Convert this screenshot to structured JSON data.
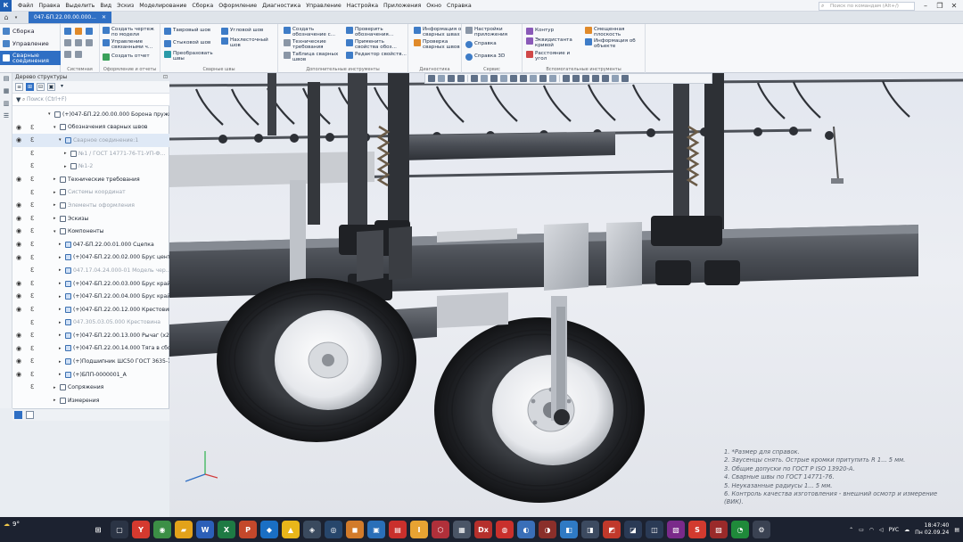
{
  "menubar": {
    "logo": "К",
    "items": [
      "Файл",
      "Правка",
      "Выделить",
      "Вид",
      "Эскиз",
      "Моделирование",
      "Сборка",
      "Оформление",
      "Диагностика",
      "Управление",
      "Настройка",
      "Приложения",
      "Окно",
      "Справка"
    ],
    "search_placeholder": "Поиск по командам (Alt+/)"
  },
  "tabbar": {
    "doc_tab": "047-БП.22.00.00.000..."
  },
  "ribbon": {
    "left_items": [
      "Сборка",
      "Управление",
      "Сварные соединения"
    ],
    "groups": [
      {
        "label": "Системная",
        "buttons": []
      },
      {
        "label": "Оформление и отчеты",
        "buttons": [
          "Создать чертеж по модели",
          "Управление связанными ч...",
          "Создать отчет"
        ]
      },
      {
        "label": "Сварные швы",
        "buttons": [
          "Тавровый шов",
          "Угловой шов",
          "Стыковой шов",
          "Нахлесточный шов",
          "Преобразовать швы"
        ]
      },
      {
        "label": "Дополнительные инструменты",
        "buttons": [
          "Создать обозначение с...",
          "Технические требования",
          "Таблица сварных швов",
          "Проверить обозначения...",
          "Применить свойства обоз...",
          "Редактор свойств..."
        ]
      },
      {
        "label": "Диагностика",
        "buttons": [
          "Информация о сварных швах",
          "Проверка сварных швов"
        ]
      },
      {
        "label": "Сервис",
        "buttons": [
          "Настройки приложения",
          "Справка",
          "Справка 3D"
        ]
      },
      {
        "label": "Вспомогательные инструменты",
        "buttons": [
          "Контур",
          "Эквидистанта кривой",
          "Расстояние и угол",
          "Смещенная плоскость",
          "Информация об объекте"
        ]
      }
    ]
  },
  "tree": {
    "title": "Дерево структуры",
    "search_placeholder": "Поиск (Ctrl+F)",
    "rows": [
      {
        "label": "(+)047-БП.22.00.00.000 Борона пружи...",
        "indent": 0
      },
      {
        "label": "Обозначения сварных швов",
        "indent": 1
      },
      {
        "label": "Сварное соединение:1",
        "indent": 2,
        "dim": true
      },
      {
        "label": "№1 / ГОСТ 14771-76-Т1-УП-Ф...",
        "indent": 3,
        "dim": true
      },
      {
        "label": "№1-2",
        "indent": 3,
        "dim": true
      },
      {
        "label": "Технические требования",
        "indent": 1
      },
      {
        "label": "Системы координат",
        "indent": 1,
        "dim": true
      },
      {
        "label": "Элементы оформления",
        "indent": 1,
        "dim": true
      },
      {
        "label": "Эскизы",
        "indent": 1
      },
      {
        "label": "Компоненты",
        "indent": 1
      },
      {
        "label": "047-БП.22.00.01.000 Сцепка",
        "indent": 2
      },
      {
        "label": "(+)047-БП.22.00.02.000 Брус центр...",
        "indent": 2
      },
      {
        "label": "047.17.04.24.000-01 Модель чер...",
        "indent": 2,
        "dim": true
      },
      {
        "label": "(+)047-БП.22.00.03.000 Брус крайн...",
        "indent": 2
      },
      {
        "label": "(+)047-БП.22.00.04.000 Брус крайн...",
        "indent": 2
      },
      {
        "label": "(+)047-БП.22.00.12.000 Крестовина...",
        "indent": 2
      },
      {
        "label": "047.305.03.05.000 Крестовина",
        "indent": 2,
        "dim": true
      },
      {
        "label": "(+)047-БП.22.00.13.000 Рычаг (x2)",
        "indent": 2
      },
      {
        "label": "(+)047-БП.22.00.14.000 Тяга в сбор...",
        "indent": 2
      },
      {
        "label": "(+)Подшипник ШС50 ГОСТ 3635-7...",
        "indent": 2
      },
      {
        "label": "(+)БПП-0000001_А",
        "indent": 2
      },
      {
        "label": "Сопряжения",
        "indent": 1
      },
      {
        "label": "Измерения",
        "indent": 1
      }
    ]
  },
  "notes": [
    "1. *Размер для справок.",
    "2. Заусенцы снять. Острые кромки притупить R 1... 5 мм.",
    "3. Общие допуски по ГОСТ Р ISO 13920-A.",
    "4. Сварные швы по ГОСТ 14771-76.",
    "5. Неуказанные радиусы 1... 5 мм.",
    "6. Контроль качества изготовления - внешний осмотр и измерение",
    "(ВИК)."
  ],
  "taskbar": {
    "weather": "9°",
    "lang": "РУС",
    "time": "18:47:40",
    "date": "Пн 02.09.24"
  },
  "colors": {
    "accent": "#2f6fc4",
    "taskbar": "#1c2230"
  }
}
